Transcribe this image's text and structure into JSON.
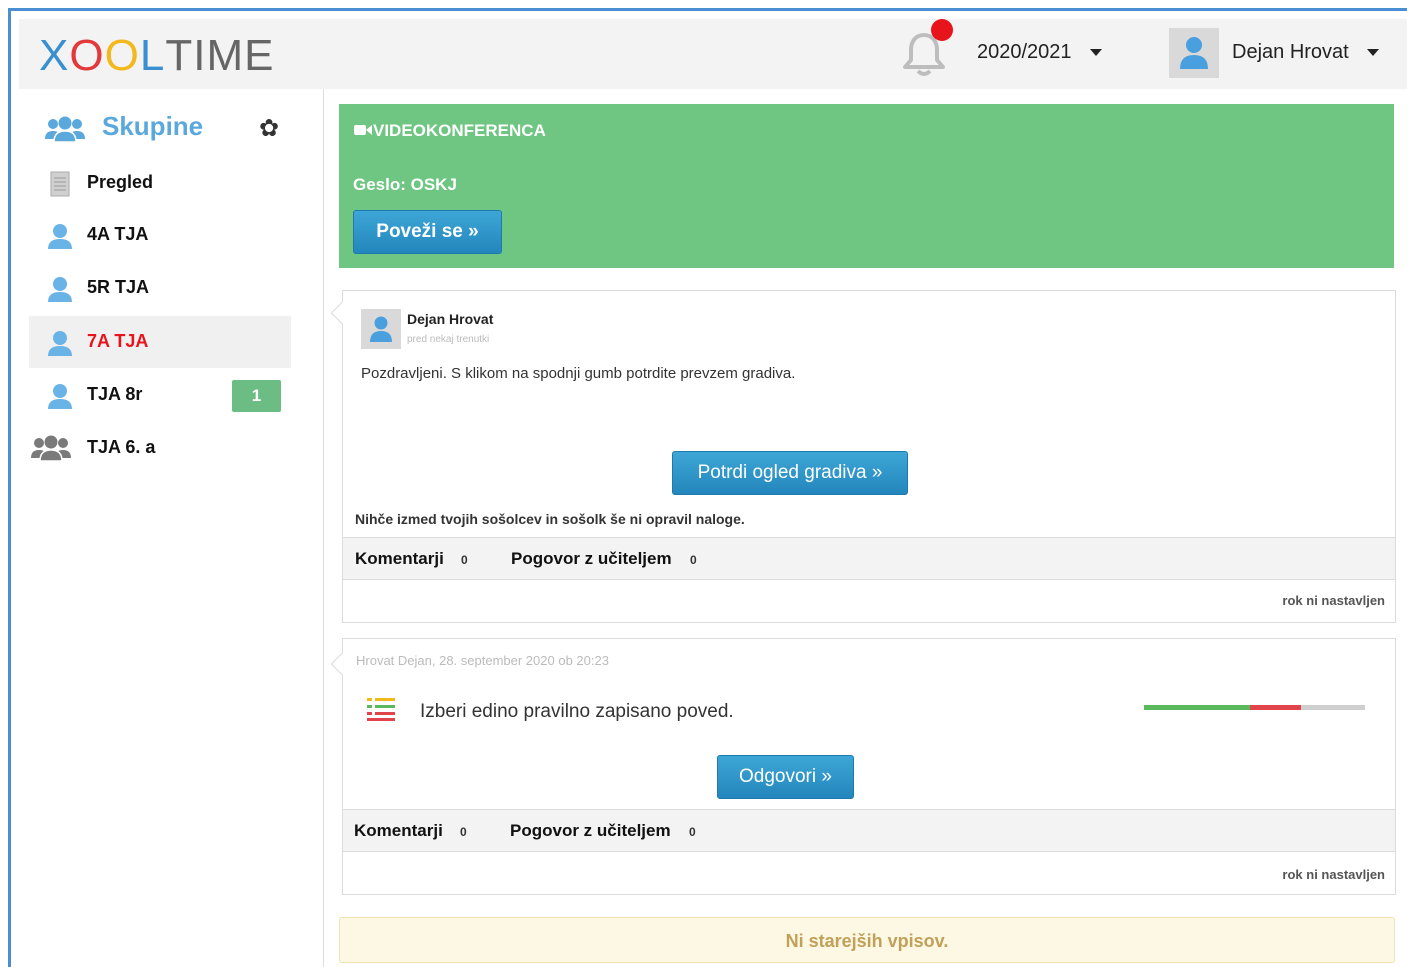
{
  "header": {
    "logo_letters": [
      {
        "ch": "X",
        "color": "#3a8fd0"
      },
      {
        "ch": "O",
        "color": "#e23a3a"
      },
      {
        "ch": "O",
        "color": "#f2b81c"
      },
      {
        "ch": "L",
        "color": "#3a8fd0"
      },
      {
        "ch": "T",
        "color": "#666666"
      },
      {
        "ch": "I",
        "color": "#666666"
      },
      {
        "ch": "M",
        "color": "#666666"
      },
      {
        "ch": "E",
        "color": "#666666"
      }
    ],
    "notification_icon": "bell-icon",
    "school_year": "2020/2021",
    "user_name": "Dejan Hrovat"
  },
  "sidebar": {
    "title": "Skupine",
    "items": [
      {
        "label": "Pregled",
        "icon": "document-icon",
        "active": false
      },
      {
        "label": "4A TJA",
        "icon": "user-icon",
        "active": false
      },
      {
        "label": "5R TJA",
        "icon": "user-icon",
        "active": false
      },
      {
        "label": "7A TJA",
        "icon": "user-icon",
        "active": true
      },
      {
        "label": "TJA 8r",
        "icon": "user-icon",
        "active": false,
        "badge": "1"
      },
      {
        "label": "TJA 6. a",
        "icon": "group-icon",
        "active": false
      }
    ]
  },
  "video": {
    "title": "VIDEOKONFERENCA",
    "password": "Geslo: OSKJ",
    "connect_label": "Poveži se »"
  },
  "post1": {
    "author": "Dejan Hrovat",
    "time": "pred nekaj trenutki",
    "message": "Pozdravljeni. S klikom na spodnji gumb potrdite prevzem gradiva.",
    "confirm_label": "Potrdi ogled gradiva »",
    "note": "Nihče izmed tvojih sošolcev in sošolk še ni opravil naloge.",
    "comments_label": "Komentarji",
    "comments_count": "0",
    "chat_label": "Pogovor z učiteljem",
    "chat_count": "0",
    "deadline": "rok ni nastavljen"
  },
  "post2": {
    "meta": "Hrovat Dejan, 28. september 2020 ob 20:23",
    "question": "Izberi edino pravilno zapisano poved.",
    "progress": {
      "correct": 0.48,
      "wrong": 0.23
    },
    "answer_label": "Odgovori »",
    "comments_label": "Komentarji",
    "comments_count": "0",
    "chat_label": "Pogovor z učiteljem",
    "chat_count": "0",
    "deadline": "rok ni nastavljen"
  },
  "older": "Ni starejših vpisov."
}
